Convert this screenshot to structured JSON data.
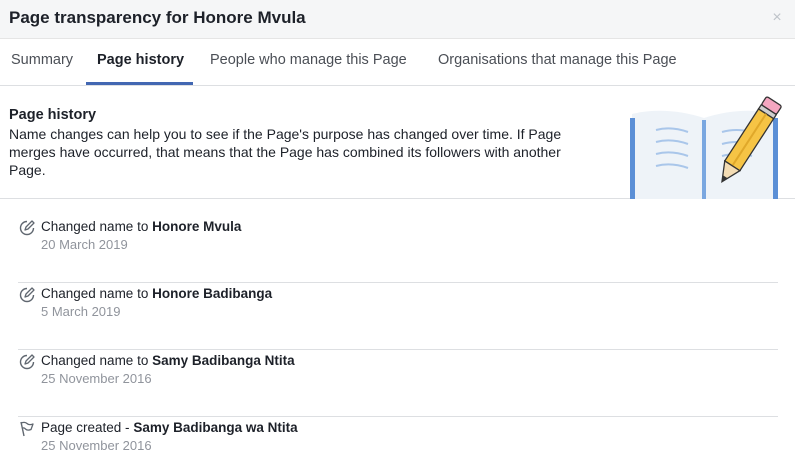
{
  "dialog": {
    "title": "Page transparency for Honore Mvula",
    "close_symbol": "×"
  },
  "tabs": [
    {
      "label": "Summary",
      "active": false
    },
    {
      "label": "Page history",
      "active": true
    },
    {
      "label": "People who manage this Page",
      "active": false
    },
    {
      "label": "Organisations that manage this Page",
      "active": false
    }
  ],
  "info": {
    "heading": "Page history",
    "description": "Name changes can help you to see if the Page's purpose has changed over time. If Page merges have occurred, that means that the Page has combined its followers with another Page.",
    "illustration": "book-and-pencil-illustration"
  },
  "history": [
    {
      "icon": "pencil-edit-icon",
      "action": "Changed name to ",
      "name": "Honore Mvula",
      "date": "20 March 2019"
    },
    {
      "icon": "pencil-edit-icon",
      "action": "Changed name to ",
      "name": "Honore Badibanga",
      "date": "5 March 2019"
    },
    {
      "icon": "pencil-edit-icon",
      "action": "Changed name to ",
      "name": "Samy Badibanga Ntita",
      "date": "25 November 2016"
    },
    {
      "icon": "flag-icon",
      "action": "Page created - ",
      "name": "Samy Badibanga wa Ntita",
      "date": "25 November 2016"
    }
  ],
  "colors": {
    "accent": "#4267b2",
    "secondary_text": "#90949c",
    "divider": "#dddfe2"
  }
}
